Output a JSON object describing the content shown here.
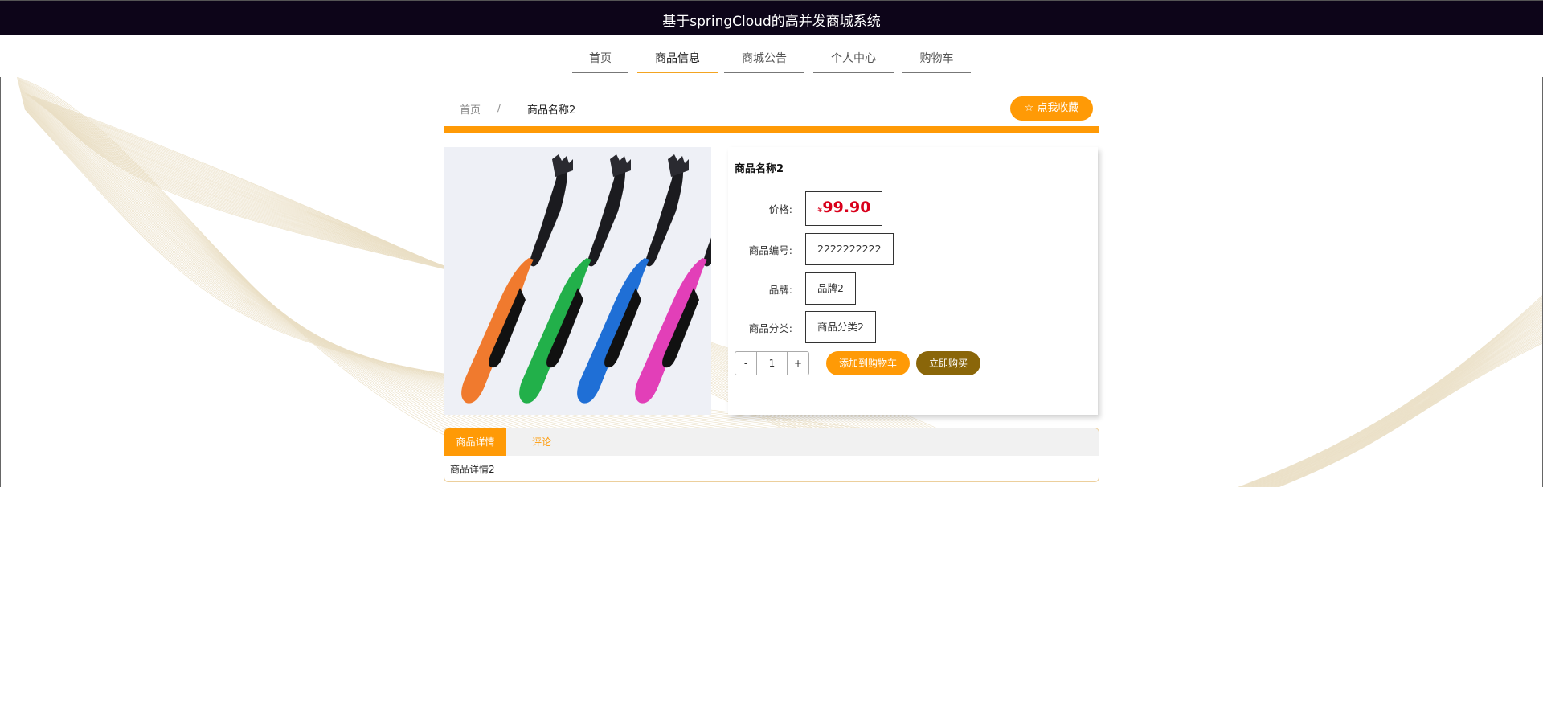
{
  "header": {
    "title": "基于springCloud的高并发商城系统"
  },
  "nav": {
    "items": [
      "首页",
      "商品信息",
      "商城公告",
      "个人中心",
      "购物车"
    ],
    "active": "商品信息"
  },
  "breadcrumb": {
    "home": "首页",
    "separator": "/",
    "current": "商品名称2"
  },
  "favorite": {
    "label": "点我收藏",
    "icon": "star-icon"
  },
  "product": {
    "name": "商品名称2",
    "price_label": "价格:",
    "price_symbol": "¥",
    "price": "99.90",
    "code_label": "商品编号:",
    "code": "2222222222",
    "brand_label": "品牌:",
    "brand": "品牌2",
    "category_label": "商品分类:",
    "category": "商品分类2",
    "quantity": "1",
    "minus": "-",
    "plus": "+",
    "add_to_cart": "添加到购物车",
    "buy_now": "立即购买"
  },
  "tabs": {
    "items": [
      "商品详情",
      "评论"
    ],
    "active": "商品详情",
    "content": "商品详情2"
  },
  "colors": {
    "accent": "#ff9a06",
    "header_bg": "#0d0519",
    "buy_button": "#8a6609",
    "price": "#d9001b"
  }
}
